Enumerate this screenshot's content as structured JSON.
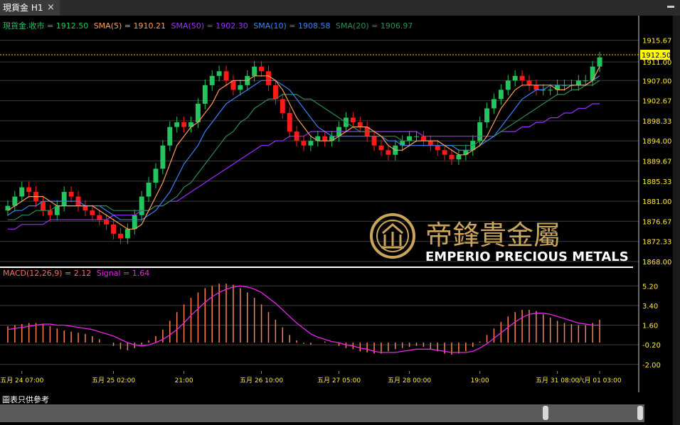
{
  "window": {
    "tab_title": "現貨金 H1",
    "close_icon": "×"
  },
  "legend": {
    "price": "現貨金.收市 = 1912.50",
    "sma5": "SMA(5) = 1910.21",
    "sma50": "SMA(50) = 1902.30",
    "sma10": "SMA(10) = 1908.58",
    "sma20": "SMA(20) = 1906.97"
  },
  "macd_legend": {
    "macd": "MACD(12,26,9) = 2.12",
    "signal": "Signal = 1.64"
  },
  "last_price_label": "1912.50",
  "watermark": {
    "cn": "帝鋒貴金屬",
    "en": "EMPERIO PRECIOUS METALS"
  },
  "footer": {
    "label": "圖表只供參考"
  },
  "colors": {
    "up": "#22c55e",
    "down": "#ff1a1a",
    "sma5": "#ff9c5b",
    "sma10": "#3b82f6",
    "sma20": "#2e8b57",
    "sma50": "#9b30ff",
    "macd": "#ff7f50",
    "signal": "#ee22ee",
    "axis_text": "#ffeb3b",
    "last_price": "#ffcc00"
  },
  "chart_data": [
    {
      "type": "line",
      "name": "price",
      "ylim": [
        1868.0,
        1917.0
      ],
      "yticks": [
        "1915.67",
        "1911.00",
        "1907.00",
        "1902.67",
        "1898.33",
        "1894.00",
        "1889.67",
        "1885.33",
        "1881.00",
        "1876.67",
        "1872.33",
        "1868.00"
      ],
      "xticks": [
        "五月 24 07:00",
        "五月 25 02:00",
        "21:00",
        "五月 26 10:00",
        "五月 27 05:00",
        "五月 28 00:00",
        "19:00",
        "五月 31 08:00",
        "六月 01 03:00"
      ],
      "close": [
        1880,
        1882,
        1884,
        1883,
        1881,
        1879,
        1878,
        1880,
        1883,
        1882,
        1880,
        1879,
        1878,
        1877,
        1876,
        1874,
        1873,
        1875,
        1878,
        1882,
        1885,
        1888,
        1893,
        1897,
        1898,
        1897,
        1898,
        1902,
        1906,
        1908,
        1909,
        1907,
        1905,
        1906,
        1908,
        1910,
        1909,
        1906,
        1903,
        1900,
        1896,
        1894,
        1893,
        1894,
        1895,
        1894,
        1895,
        1897,
        1899,
        1898,
        1897,
        1895,
        1893,
        1892,
        1891,
        1893,
        1894,
        1895,
        1895,
        1894,
        1893,
        1892,
        1891,
        1890,
        1891,
        1892,
        1894,
        1898,
        1901,
        1903,
        1905,
        1907,
        1908,
        1907,
        1906,
        1905,
        1905,
        1905,
        1906,
        1906,
        1906,
        1907,
        1907,
        1910,
        1912
      ],
      "sma5": [
        1879,
        1880,
        1881,
        1882,
        1882,
        1882,
        1881,
        1880,
        1880,
        1880,
        1880,
        1880,
        1880,
        1879,
        1878,
        1877,
        1876,
        1875,
        1875,
        1876,
        1879,
        1882,
        1885,
        1889,
        1893,
        1895,
        1897,
        1898,
        1900,
        1902,
        1905,
        1906,
        1907,
        1907,
        1907,
        1908,
        1908,
        1908,
        1907,
        1905,
        1902,
        1899,
        1897,
        1895,
        1894,
        1894,
        1894,
        1895,
        1896,
        1897,
        1897,
        1897,
        1896,
        1895,
        1893,
        1892,
        1892,
        1893,
        1894,
        1894,
        1894,
        1894,
        1893,
        1892,
        1891,
        1891,
        1892,
        1893,
        1895,
        1898,
        1901,
        1903,
        1905,
        1906,
        1906,
        1906,
        1906,
        1906,
        1905,
        1905,
        1906,
        1906,
        1906,
        1907,
        1910
      ],
      "sma10": [
        1878,
        1879,
        1879,
        1880,
        1880,
        1881,
        1881,
        1881,
        1881,
        1881,
        1881,
        1880,
        1880,
        1880,
        1879,
        1878,
        1877,
        1877,
        1877,
        1877,
        1878,
        1879,
        1881,
        1883,
        1886,
        1889,
        1891,
        1893,
        1896,
        1898,
        1900,
        1902,
        1903,
        1904,
        1905,
        1906,
        1907,
        1907,
        1907,
        1906,
        1905,
        1903,
        1901,
        1899,
        1897,
        1896,
        1895,
        1895,
        1895,
        1895,
        1895,
        1895,
        1895,
        1895,
        1894,
        1894,
        1893,
        1893,
        1893,
        1893,
        1893,
        1893,
        1893,
        1893,
        1892,
        1892,
        1892,
        1893,
        1894,
        1895,
        1897,
        1899,
        1901,
        1903,
        1904,
        1905,
        1905,
        1906,
        1906,
        1906,
        1906,
        1906,
        1906,
        1907,
        1908
      ],
      "sma20": [
        1877,
        1877,
        1878,
        1878,
        1879,
        1879,
        1879,
        1880,
        1880,
        1880,
        1880,
        1880,
        1880,
        1880,
        1880,
        1879,
        1879,
        1879,
        1879,
        1879,
        1879,
        1880,
        1880,
        1881,
        1882,
        1884,
        1885,
        1887,
        1889,
        1891,
        1893,
        1895,
        1896,
        1898,
        1899,
        1901,
        1902,
        1903,
        1903,
        1904,
        1904,
        1904,
        1903,
        1903,
        1902,
        1901,
        1900,
        1899,
        1898,
        1897,
        1896,
        1896,
        1896,
        1895,
        1895,
        1895,
        1894,
        1894,
        1894,
        1894,
        1894,
        1894,
        1893,
        1893,
        1893,
        1893,
        1893,
        1894,
        1894,
        1895,
        1896,
        1897,
        1898,
        1899,
        1900,
        1901,
        1902,
        1903,
        1904,
        1904,
        1905,
        1905,
        1906,
        1906,
        1907
      ],
      "sma50": [
        1875,
        1875,
        1876,
        1876,
        1876,
        1876,
        1877,
        1877,
        1877,
        1877,
        1877,
        1877,
        1877,
        1877,
        1877,
        1878,
        1878,
        1878,
        1878,
        1879,
        1879,
        1880,
        1880,
        1881,
        1881,
        1882,
        1883,
        1884,
        1885,
        1886,
        1887,
        1888,
        1889,
        1890,
        1891,
        1892,
        1893,
        1893,
        1894,
        1894,
        1895,
        1895,
        1895,
        1896,
        1896,
        1896,
        1896,
        1896,
        1896,
        1896,
        1896,
        1896,
        1896,
        1896,
        1896,
        1896,
        1896,
        1896,
        1896,
        1895,
        1895,
        1895,
        1895,
        1895,
        1895,
        1895,
        1895,
        1895,
        1895,
        1895,
        1896,
        1896,
        1896,
        1897,
        1897,
        1898,
        1898,
        1899,
        1899,
        1900,
        1900,
        1901,
        1901,
        1902,
        1902
      ]
    },
    {
      "type": "bar",
      "name": "macd",
      "ylim": [
        -2.6,
        6.0
      ],
      "yticks": [
        "5.20",
        "3.40",
        "1.60",
        "-0.20",
        "-2.00"
      ],
      "histogram": [
        1.5,
        1.6,
        1.7,
        1.8,
        1.8,
        1.7,
        1.5,
        1.3,
        1.1,
        1.0,
        0.9,
        0.8,
        0.6,
        0.3,
        0.0,
        -0.3,
        -0.6,
        -0.7,
        -0.5,
        -0.2,
        0.2,
        0.6,
        1.2,
        2.0,
        2.8,
        3.5,
        4.1,
        4.6,
        5.0,
        5.2,
        5.4,
        5.4,
        5.3,
        5.0,
        4.6,
        4.1,
        3.5,
        2.8,
        2.1,
        1.4,
        0.7,
        0.2,
        -0.1,
        -0.2,
        0.0,
        0.1,
        0.0,
        -0.3,
        -0.5,
        -0.6,
        -0.8,
        -0.9,
        -1.0,
        -1.0,
        -0.8,
        -0.6,
        -0.5,
        -0.4,
        -0.3,
        -0.4,
        -0.6,
        -0.8,
        -1.0,
        -1.1,
        -1.0,
        -0.8,
        -0.4,
        0.1,
        0.7,
        1.3,
        1.9,
        2.4,
        2.8,
        3.0,
        3.0,
        2.9,
        2.6,
        2.3,
        2.0,
        1.8,
        1.7,
        1.6,
        1.6,
        1.8,
        2.1
      ],
      "signal": [
        1.2,
        1.3,
        1.4,
        1.5,
        1.6,
        1.7,
        1.7,
        1.6,
        1.6,
        1.5,
        1.4,
        1.3,
        1.2,
        1.0,
        0.8,
        0.6,
        0.3,
        0.0,
        -0.2,
        -0.3,
        -0.2,
        0.0,
        0.3,
        0.7,
        1.2,
        1.8,
        2.5,
        3.1,
        3.7,
        4.2,
        4.6,
        4.9,
        5.1,
        5.2,
        5.1,
        4.9,
        4.6,
        4.1,
        3.6,
        3.0,
        2.4,
        1.8,
        1.3,
        0.8,
        0.5,
        0.3,
        0.1,
        0.0,
        -0.2,
        -0.3,
        -0.5,
        -0.6,
        -0.8,
        -0.9,
        -0.9,
        -0.9,
        -0.8,
        -0.7,
        -0.6,
        -0.6,
        -0.6,
        -0.7,
        -0.8,
        -0.9,
        -0.9,
        -0.9,
        -0.8,
        -0.5,
        -0.1,
        0.4,
        0.9,
        1.4,
        1.9,
        2.3,
        2.6,
        2.7,
        2.7,
        2.6,
        2.4,
        2.2,
        2.0,
        1.8,
        1.7,
        1.6,
        1.6
      ]
    }
  ]
}
